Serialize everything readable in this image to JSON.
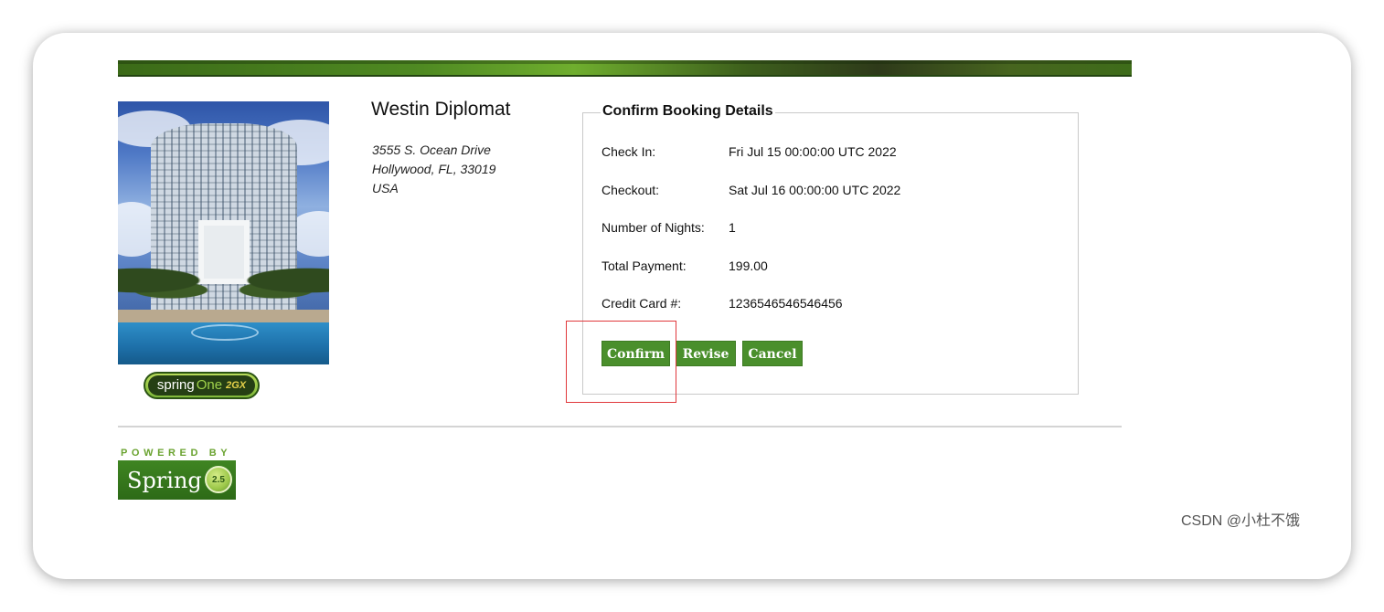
{
  "hotel": {
    "name": "Westin Diplomat",
    "address": [
      "3555 S. Ocean Drive",
      "Hollywood, FL, 33019",
      "USA"
    ]
  },
  "booking": {
    "legend": "Confirm Booking Details",
    "rows": [
      {
        "label": "Check In:",
        "value": "Fri Jul 15 00:00:00 UTC 2022"
      },
      {
        "label": "Checkout:",
        "value": "Sat Jul 16 00:00:00 UTC 2022"
      },
      {
        "label": "Number of Nights:",
        "value": "1"
      },
      {
        "label": "Total Payment:",
        "value": "199.00"
      },
      {
        "label": "Credit Card #:",
        "value": "1236546546546456"
      }
    ]
  },
  "actions": {
    "confirm": "Confirm",
    "revise": "Revise",
    "cancel": "Cancel"
  },
  "logos": {
    "spring_one": {
      "spring": "spring",
      "one": "One",
      "tag": "2GX"
    },
    "powered_by": "POWERED BY",
    "spring": "Spring",
    "spring_badge": "2.5"
  },
  "watermark": "CSDN @小杜不饿",
  "colors": {
    "button": "#4a8f2c",
    "banner": "#3e6c1a",
    "highlight": "#e0383b"
  }
}
